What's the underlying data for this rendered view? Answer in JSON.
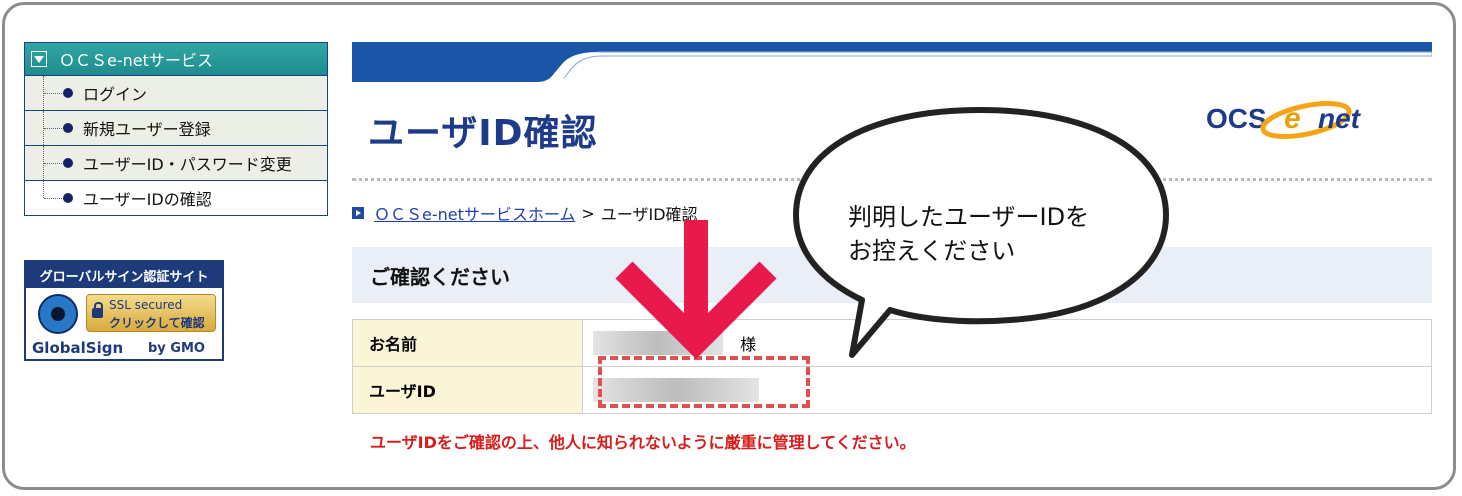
{
  "sidebar": {
    "title": "ＯＣＳe-netサービス",
    "items": [
      {
        "label": "ログイン"
      },
      {
        "label": "新規ユーザー登録"
      },
      {
        "label": "ユーザーID・パスワード変更"
      },
      {
        "label": "ユーザーIDの確認"
      }
    ]
  },
  "seal": {
    "header": "グローバルサイン認証サイト",
    "ssl": "SSL secured",
    "click": "クリックして確認",
    "brand": "GlobalSign",
    "by": "by GMO"
  },
  "page": {
    "title": "ユーザID確認",
    "logo_text": "OCSenet"
  },
  "breadcrumb": {
    "home_link": "ＯＣＳe-netサービスホーム",
    "separator": ">",
    "current": "ユーザID確認"
  },
  "section": {
    "heading": "ご確認ください"
  },
  "table": {
    "rows": [
      {
        "label": "お名前",
        "suffix": "様"
      },
      {
        "label": "ユーザID",
        "suffix": ""
      }
    ]
  },
  "warning": "ユーザIDをご確認の上、他人に知られないように厳重に管理してください。",
  "callout": {
    "line1": "判明したユーザーIDを",
    "line2": "お控えください"
  },
  "colors": {
    "title_blue": "#1e3a8a",
    "banner_blue": "#1a55a8",
    "sidebar_teal": "#2a9a9a",
    "warning_red": "#d81b1b",
    "arrow_pink": "#e8194b"
  }
}
